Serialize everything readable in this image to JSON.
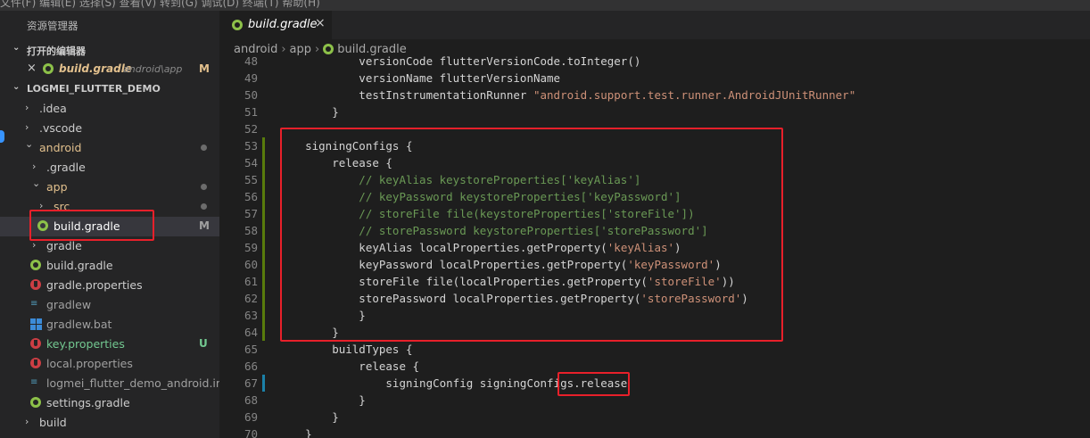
{
  "titlebar": {
    "menu_text": "文件(F)  编辑(E)  选择(S)  查看(V)  转到(G)  调试(D)  终端(T)  帮助(H)"
  },
  "explorer": {
    "title": "资源管理器",
    "open_editors": {
      "header": "打开的编辑器",
      "items": [
        {
          "name": "build.gradle",
          "path": "android\\app",
          "status": "M"
        }
      ]
    },
    "project": {
      "header": "LOGMEI_FLUTTER_DEMO",
      "tree": [
        {
          "label": ".idea",
          "kind": "folder",
          "expanded": false,
          "status": ""
        },
        {
          "label": ".vscode",
          "kind": "folder",
          "expanded": false,
          "status": ""
        },
        {
          "label": "android",
          "kind": "folder",
          "expanded": true,
          "status": "dot"
        },
        {
          "label": ".gradle",
          "kind": "folder",
          "expanded": false,
          "status": ""
        },
        {
          "label": "app",
          "kind": "folder",
          "expanded": true,
          "status": "dot"
        },
        {
          "label": "src",
          "kind": "folder",
          "expanded": false,
          "status": "dot"
        },
        {
          "label": "build.gradle",
          "kind": "gradle",
          "status": "M"
        },
        {
          "label": "gradle",
          "kind": "folder",
          "expanded": false,
          "status": ""
        },
        {
          "label": "build.gradle",
          "kind": "gradle",
          "status": ""
        },
        {
          "label": "gradle.properties",
          "kind": "properties",
          "status": ""
        },
        {
          "label": "gradlew",
          "kind": "file",
          "status": ""
        },
        {
          "label": "gradlew.bat",
          "kind": "windows",
          "status": ""
        },
        {
          "label": "key.properties",
          "kind": "properties",
          "status": "U"
        },
        {
          "label": "local.properties",
          "kind": "properties",
          "status": ""
        },
        {
          "label": "logmei_flutter_demo_android.iml",
          "kind": "iml",
          "status": ""
        },
        {
          "label": "settings.gradle",
          "kind": "gradle",
          "status": ""
        },
        {
          "label": "build",
          "kind": "folder",
          "expanded": false,
          "status": ""
        }
      ]
    }
  },
  "editor": {
    "tab": {
      "label": "build.gradle",
      "close": "×"
    },
    "breadcrumb": [
      "android",
      "app",
      "build.gradle"
    ],
    "lines": [
      {
        "n": "48",
        "text": "            versionCode flutterVersionCode.toInteger()"
      },
      {
        "n": "49",
        "text": "            versionName flutterVersionName"
      },
      {
        "n": "50",
        "text": "            testInstrumentationRunner \"android.support.test.runner.AndroidJUnitRunner\""
      },
      {
        "n": "51",
        "text": "        }"
      },
      {
        "n": "52",
        "text": ""
      },
      {
        "n": "53",
        "text": "    signingConfigs {"
      },
      {
        "n": "54",
        "text": "        release {"
      },
      {
        "n": "55",
        "text": "            // keyAlias keystoreProperties['keyAlias']"
      },
      {
        "n": "56",
        "text": "            // keyPassword keystoreProperties['keyPassword']"
      },
      {
        "n": "57",
        "text": "            // storeFile file(keystoreProperties['storeFile'])"
      },
      {
        "n": "58",
        "text": "            // storePassword keystoreProperties['storePassword']"
      },
      {
        "n": "59",
        "text": "            keyAlias localProperties.getProperty('keyAlias')"
      },
      {
        "n": "60",
        "text": "            keyPassword localProperties.getProperty('keyPassword')"
      },
      {
        "n": "61",
        "text": "            storeFile file(localProperties.getProperty('storeFile'))"
      },
      {
        "n": "62",
        "text": "            storePassword localProperties.getProperty('storePassword')"
      },
      {
        "n": "63",
        "text": "            }"
      },
      {
        "n": "64",
        "text": "        }"
      },
      {
        "n": "65",
        "text": "        buildTypes {"
      },
      {
        "n": "66",
        "text": "            release {"
      },
      {
        "n": "67",
        "text": "                signingConfig signingConfigs.release"
      },
      {
        "n": "68",
        "text": "            }"
      },
      {
        "n": "69",
        "text": "        }"
      },
      {
        "n": "70",
        "text": "    }"
      }
    ]
  },
  "colors": {
    "modified_badge": "#e2c08d",
    "untracked_badge": "#73c991",
    "highlight_box": "#e8202a",
    "added_gutter": "#587c0c",
    "modified_gutter": "#1b81a8"
  }
}
